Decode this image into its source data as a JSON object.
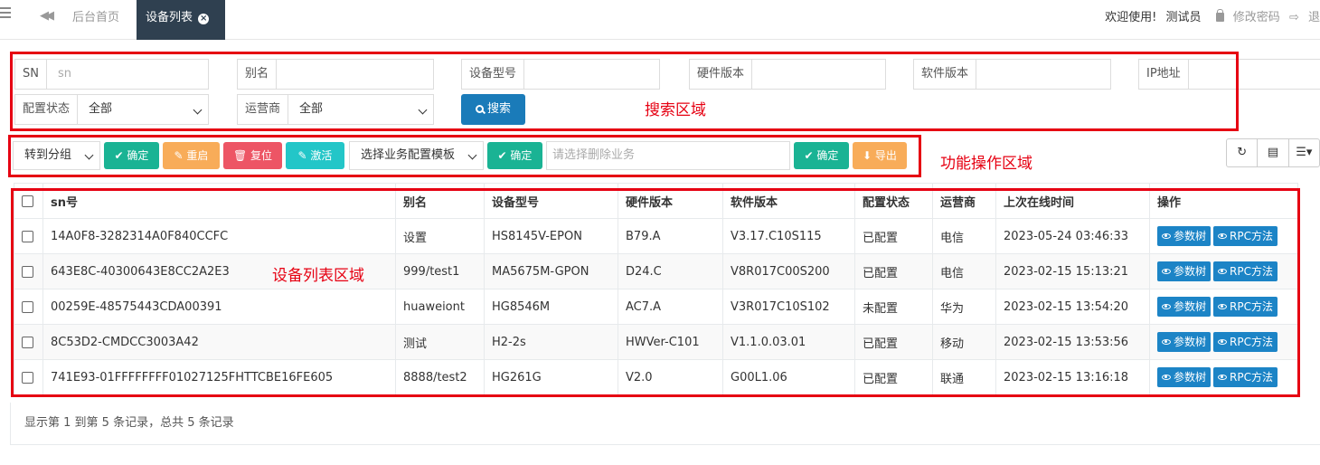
{
  "topbar": {
    "home_tab": "后台首页",
    "active_tab": "设备列表",
    "welcome": "欢迎使用!",
    "user": "测试员",
    "change_password": "修改密码",
    "logout": "退"
  },
  "search": {
    "sn_label": "SN",
    "sn_placeholder": "sn",
    "alias_label": "别名",
    "model_label": "设备型号",
    "hw_label": "硬件版本",
    "sw_label": "软件版本",
    "ip_label": "IP地址",
    "config_label": "配置状态",
    "config_value": "全部",
    "carrier_label": "运营商",
    "carrier_value": "全部",
    "search_button": "搜索",
    "region_label": "搜索区域"
  },
  "actions": {
    "group_select": "转到分组",
    "confirm": "确定",
    "restart": "重启",
    "reset": "复位",
    "activate": "激活",
    "template_select": "选择业务配置模板",
    "delete_placeholder": "请选择删除业务",
    "export": "导出",
    "region_label": "功能操作区域"
  },
  "table": {
    "region_label": "设备列表区域",
    "headers": [
      "sn号",
      "别名",
      "设备型号",
      "硬件版本",
      "软件版本",
      "配置状态",
      "运营商",
      "上次在线时间",
      "操作"
    ],
    "rows": [
      [
        "14A0F8-3282314A0F840CCFC",
        "设置",
        "HS8145V-EPON",
        "B79.A",
        "V3.17.C10S115",
        "已配置",
        "电信",
        "2023-05-24 03:46:33"
      ],
      [
        "643E8C-40300643E8CC2A2E3",
        "999/test1",
        "MA5675M-GPON",
        "D24.C",
        "V8R017C00S200",
        "已配置",
        "电信",
        "2023-02-15 15:13:21"
      ],
      [
        "00259E-48575443CDA00391",
        "huaweiont",
        "HG8546M",
        "AC7.A",
        "V3R017C10S102",
        "未配置",
        "华为",
        "2023-02-15 13:54:20"
      ],
      [
        "8C53D2-CMDCC3003A42",
        "测试",
        "H2-2s",
        "HWVer-C101",
        "V1.1.0.03.01",
        "已配置",
        "移动",
        "2023-02-15 13:53:56"
      ],
      [
        "741E93-01FFFFFFFF01027125FHTTCBE16FE605",
        "8888/test2",
        "HG261G",
        "V2.0",
        "G00L1.06",
        "已配置",
        "联通",
        "2023-02-15 13:16:18"
      ]
    ],
    "op_param_tree": "参数树",
    "op_rpc": "RPC方法",
    "footer": "显示第 1 到第 5 条记录，总共 5 条记录"
  },
  "colors": {
    "annotation_red": "#e60012",
    "green": "#1ab394",
    "orange": "#f8ac59",
    "red": "#ed5565",
    "cyan": "#23c6c8",
    "blue": "#1c84c6",
    "dark_tab": "#2f4050"
  }
}
